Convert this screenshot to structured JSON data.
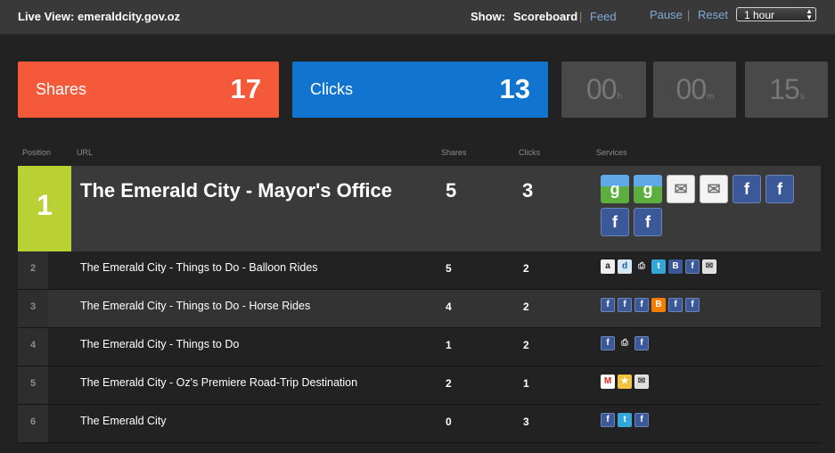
{
  "header": {
    "live_view": "Live View: emeraldcity.gov.oz",
    "show_label": "Show:",
    "nav_scoreboard": "Scoreboard",
    "separator": "|",
    "nav_feed": "Feed",
    "pause": "Pause",
    "reset": "Reset",
    "range_select": "1 hour"
  },
  "stats": {
    "shares_label": "Shares",
    "shares_value": "17",
    "clicks_label": "Clicks",
    "clicks_value": "13"
  },
  "timer": {
    "hours": "00",
    "hours_unit": "h",
    "minutes": "00",
    "minutes_unit": "m",
    "seconds": "15",
    "seconds_unit": "s"
  },
  "table": {
    "headers": [
      "Position",
      "URL",
      "Shares",
      "Clicks",
      "Services"
    ],
    "rows": [
      {
        "position": "1",
        "title": "The Emerald City - Mayor's Office",
        "shares": "5",
        "clicks": "3",
        "services": [
          "google-icon",
          "google-icon",
          "email-icon",
          "email-icon",
          "facebook-icon",
          "facebook-icon",
          "facebook-icon",
          "facebook-icon"
        ]
      },
      {
        "position": "2",
        "title": "The Emerald City - Things to Do - Balloon Rides",
        "shares": "5",
        "clicks": "2",
        "services": [
          "amazon-icon",
          "digg-icon",
          "print-icon",
          "twitter-icon",
          "blogger-icon",
          "facebook-icon",
          "email-icon"
        ]
      },
      {
        "position": "3",
        "title": "The Emerald City - Things to Do - Horse Rides",
        "shares": "4",
        "clicks": "2",
        "services": [
          "facebook-icon",
          "facebook-icon",
          "facebook-icon",
          "blogger-icon",
          "facebook-icon",
          "facebook-icon"
        ]
      },
      {
        "position": "4",
        "title": "The Emerald City - Things to Do",
        "shares": "1",
        "clicks": "2",
        "services": [
          "facebook-icon",
          "print-icon",
          "facebook-icon"
        ]
      },
      {
        "position": "5",
        "title": "The Emerald City - Oz's Premiere Road-Trip Destination",
        "shares": "2",
        "clicks": "1",
        "services": [
          "gmail-icon",
          "favorite-icon",
          "email-icon"
        ]
      },
      {
        "position": "6",
        "title": "The Emerald City",
        "shares": "0",
        "clicks": "3",
        "services": [
          "facebook-icon",
          "twitter-icon",
          "facebook-icon"
        ]
      }
    ]
  },
  "colors": {
    "shares": "#f4593a",
    "clicks": "#1174cf",
    "top_position": "#b9d133",
    "link": "#7fa9d6"
  }
}
